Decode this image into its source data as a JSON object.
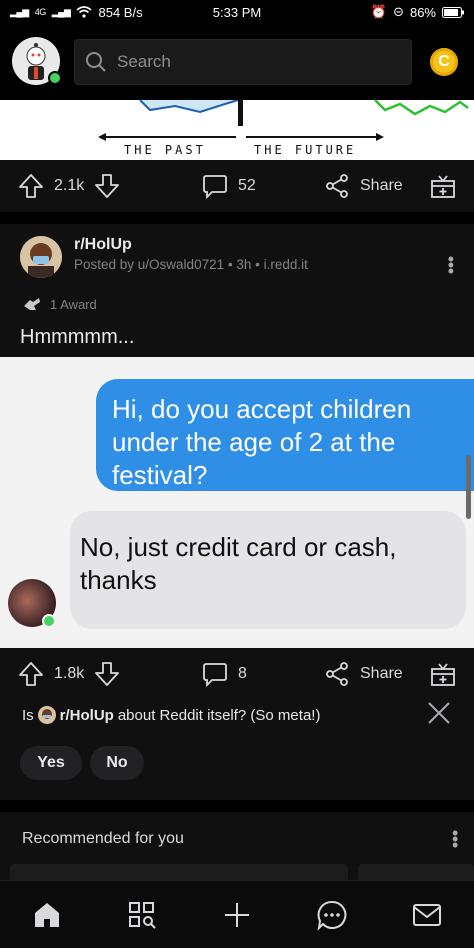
{
  "status_bar": {
    "network": "4G",
    "speed": "854 B/s",
    "time": "5:33 PM",
    "battery": "86%"
  },
  "app_bar": {
    "search_placeholder": "Search",
    "coin_symbol": "C"
  },
  "previous_post": {
    "image_label_left": "THE PAST",
    "image_label_right": "THE FUTURE",
    "upvotes": "2.1k",
    "comments": "52",
    "share_label": "Share"
  },
  "post": {
    "subreddit": "r/HolUp",
    "byline": "Posted by u/Oswald0721 • 3h • i.redd.it",
    "awards": "1 Award",
    "title": "Hmmmmm...",
    "image_messages": {
      "sent": "Hi, do you accept children under the age of 2 at the festival?",
      "received": "No, just credit card or cash, thanks"
    },
    "upvotes": "1.8k",
    "comments": "8",
    "share_label": "Share"
  },
  "meta_question": {
    "prefix": "Is",
    "subreddit": "r/HolUp",
    "suffix": "about Reddit itself? (So meta!)",
    "yes_label": "Yes",
    "no_label": "No"
  },
  "recommended": {
    "title": "Recommended for you"
  },
  "bottom_nav": [
    "home-icon",
    "discover-icon",
    "create-icon",
    "chat-icon",
    "inbox-icon"
  ],
  "colors": {
    "online": "#46d160",
    "coin": "#f7c31b",
    "bubble_blue": "#2f8fe6",
    "bubble_gray": "#e4e4e6"
  }
}
